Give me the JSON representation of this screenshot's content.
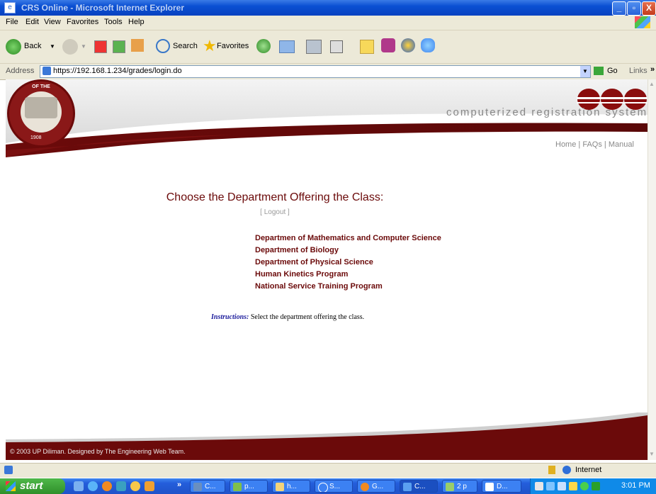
{
  "window": {
    "title": "CRS Online - Microsoft Internet Explorer",
    "min": "_",
    "max": "▫",
    "close": "X"
  },
  "menu": [
    "File",
    "Edit",
    "View",
    "Favorites",
    "Tools",
    "Help"
  ],
  "toolbar": {
    "back": "Back",
    "search": "Search",
    "favorites": "Favorites"
  },
  "address": {
    "label": "Address",
    "url": "https://192.168.1.234/grades/login.do",
    "go": "Go",
    "links": "Links"
  },
  "header": {
    "brand": "computerized registration system",
    "seal_top": "OF THE",
    "seal_year": "1908"
  },
  "nav": {
    "home": "Home",
    "faqs": "FAQs",
    "manual": "Manual",
    "sep": "|"
  },
  "main": {
    "heading": "Choose the Department Offering the Class:",
    "logout": "[ Logout ]",
    "departments": [
      "Departmen of Mathematics and Computer Science",
      "Department of Biology",
      "Department of Physical Science",
      "Human Kinetics Program",
      "National Service Training Program"
    ],
    "instructions_label": "Instructions:",
    "instructions_text": "Select the department offering the class."
  },
  "footer": {
    "copyright": "© 2003 UP Diliman. Designed by The Engineering Web Team."
  },
  "status": {
    "zone": "Internet"
  },
  "taskbar": {
    "start": "start",
    "more": "»",
    "tasks": [
      "C...",
      "p...",
      "h...",
      "S...",
      "G...",
      "C...",
      "2 p",
      "D..."
    ],
    "clock": "3:01 PM"
  },
  "colors": {
    "maroon": "#6b0a0a",
    "link_blue": "#1c1c9c",
    "title_blue": "#0a4fd2"
  }
}
